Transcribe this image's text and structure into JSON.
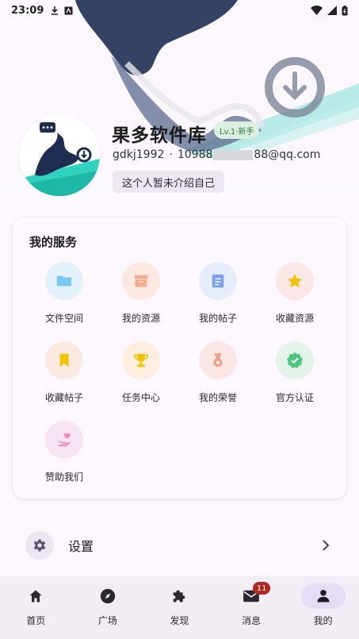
{
  "status_bar": {
    "time": "23:09"
  },
  "profile": {
    "name": "果多软件库",
    "level": "Lv.1·新手",
    "username": "gdkj1992",
    "separator": "·",
    "email_prefix": "10988",
    "email_suffix": "88@qq.com",
    "bio": "这个人暂未介绍自己"
  },
  "services": {
    "title": "我的服务",
    "items": [
      {
        "label": "文件空间",
        "icon": "folder-icon",
        "color": "#7cc9f0",
        "bg": "#e3f1fb"
      },
      {
        "label": "我的资源",
        "icon": "archive-box-icon",
        "color": "#f5a98a",
        "bg": "#fde9e2"
      },
      {
        "label": "我的帖子",
        "icon": "document-icon",
        "color": "#7ea2e8",
        "bg": "#e6ecfa"
      },
      {
        "label": "收藏资源",
        "icon": "star-icon",
        "color": "#f2c300",
        "bg": "#fbe7e6"
      },
      {
        "label": "收藏帖子",
        "icon": "bookmark-icon",
        "color": "#f2c300",
        "bg": "#fbeae0"
      },
      {
        "label": "任务中心",
        "icon": "trophy-icon",
        "color": "#f2c300",
        "bg": "#fdeee0"
      },
      {
        "label": "我的荣誉",
        "icon": "medal-icon",
        "color": "#f0a08c",
        "bg": "#fbe6e6"
      },
      {
        "label": "官方认证",
        "icon": "verified-badge-icon",
        "color": "#4cc77f",
        "bg": "#e3f3ea"
      },
      {
        "label": "赞助我们",
        "icon": "heart-hand-icon",
        "color": "#f08fc0",
        "bg": "#f6e3f3"
      }
    ]
  },
  "settings": {
    "label": "设置"
  },
  "bottom_nav": {
    "items": [
      {
        "label": "首页",
        "icon": "home-icon"
      },
      {
        "label": "广场",
        "icon": "compass-icon"
      },
      {
        "label": "发现",
        "icon": "puzzle-icon"
      },
      {
        "label": "消息",
        "icon": "mail-icon",
        "badge": "11"
      },
      {
        "label": "我的",
        "icon": "person-icon",
        "active": true
      }
    ]
  },
  "colors": {
    "accent": "#e6dcf6",
    "badge": "#b3261e",
    "level_badge_bg": "#dcf0e1",
    "level_badge_text": "#2f7a45"
  }
}
